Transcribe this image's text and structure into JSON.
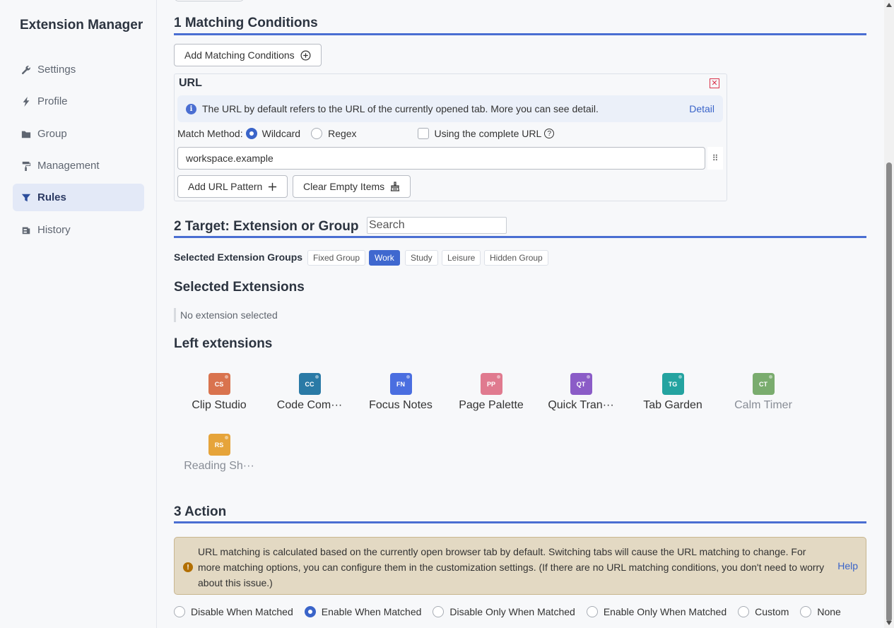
{
  "sidebar": {
    "title": "Extension Manager",
    "items": [
      {
        "label": "Settings",
        "icon": "wrench-icon"
      },
      {
        "label": "Profile",
        "icon": "lightning-icon"
      },
      {
        "label": "Group",
        "icon": "folder-icon"
      },
      {
        "label": "Management",
        "icon": "paint-roller-icon"
      },
      {
        "label": "Rules",
        "icon": "funnel-icon",
        "active": true
      },
      {
        "label": "History",
        "icon": "history-icon"
      }
    ]
  },
  "matching": {
    "title": "1 Matching Conditions",
    "add_button": "Add Matching Conditions",
    "url_label": "URL",
    "info_text": "The URL by default refers to the URL of the currently opened tab. More you can see detail.",
    "detail_link": "Detail",
    "match_method_label": "Match Method:",
    "wildcard_label": "Wildcard",
    "regex_label": "Regex",
    "complete_url_label": "Using the complete URL",
    "url_value": "workspace.example",
    "add_pattern_button": "Add URL Pattern",
    "clear_empty_button": "Clear Empty Items"
  },
  "target": {
    "title": "2 Target: Extension or Group",
    "search_placeholder": "Search",
    "groups_label": "Selected Extension Groups",
    "groups": [
      {
        "label": "Fixed Group",
        "selected": false
      },
      {
        "label": "Work",
        "selected": true
      },
      {
        "label": "Study",
        "selected": false
      },
      {
        "label": "Leisure",
        "selected": false
      },
      {
        "label": "Hidden Group",
        "selected": false
      }
    ],
    "selected_title": "Selected Extensions",
    "empty_note": "No extension selected",
    "left_title": "Left extensions",
    "extensions": [
      {
        "abbr": "CS",
        "name": "Clip Studio",
        "color": "#d9734e",
        "enabled": true
      },
      {
        "abbr": "CC",
        "name": "Code Com···",
        "color": "#2a7aa6",
        "enabled": true
      },
      {
        "abbr": "FN",
        "name": "Focus Notes",
        "color": "#4a6ee0",
        "enabled": true
      },
      {
        "abbr": "PP",
        "name": "Page Palette",
        "color": "#e07a8f",
        "enabled": true
      },
      {
        "abbr": "QT",
        "name": "Quick Tran···",
        "color": "#8b5cc7",
        "enabled": true
      },
      {
        "abbr": "TG",
        "name": "Tab Garden",
        "color": "#24a3a0",
        "enabled": true
      },
      {
        "abbr": "CT",
        "name": "Calm Timer",
        "color": "#7aac6e",
        "enabled": false
      },
      {
        "abbr": "RS",
        "name": "Reading Sh···",
        "color": "#e6a43a",
        "enabled": false
      }
    ]
  },
  "action": {
    "title": "3 Action",
    "warning": "URL matching is calculated based on the currently open browser tab by default. Switching tabs will cause the URL matching to change. For more matching options, you can configure them in the customization settings. (If there are no URL matching conditions, you don't need to worry about this issue.)",
    "help_link": "Help",
    "options": [
      {
        "label": "Disable When Matched",
        "selected": false
      },
      {
        "label": "Enable When Matched",
        "selected": true
      },
      {
        "label": "Disable Only When Matched",
        "selected": false
      },
      {
        "label": "Enable Only When Matched",
        "selected": false
      },
      {
        "label": "Custom",
        "selected": false
      },
      {
        "label": "None",
        "selected": false
      }
    ]
  }
}
